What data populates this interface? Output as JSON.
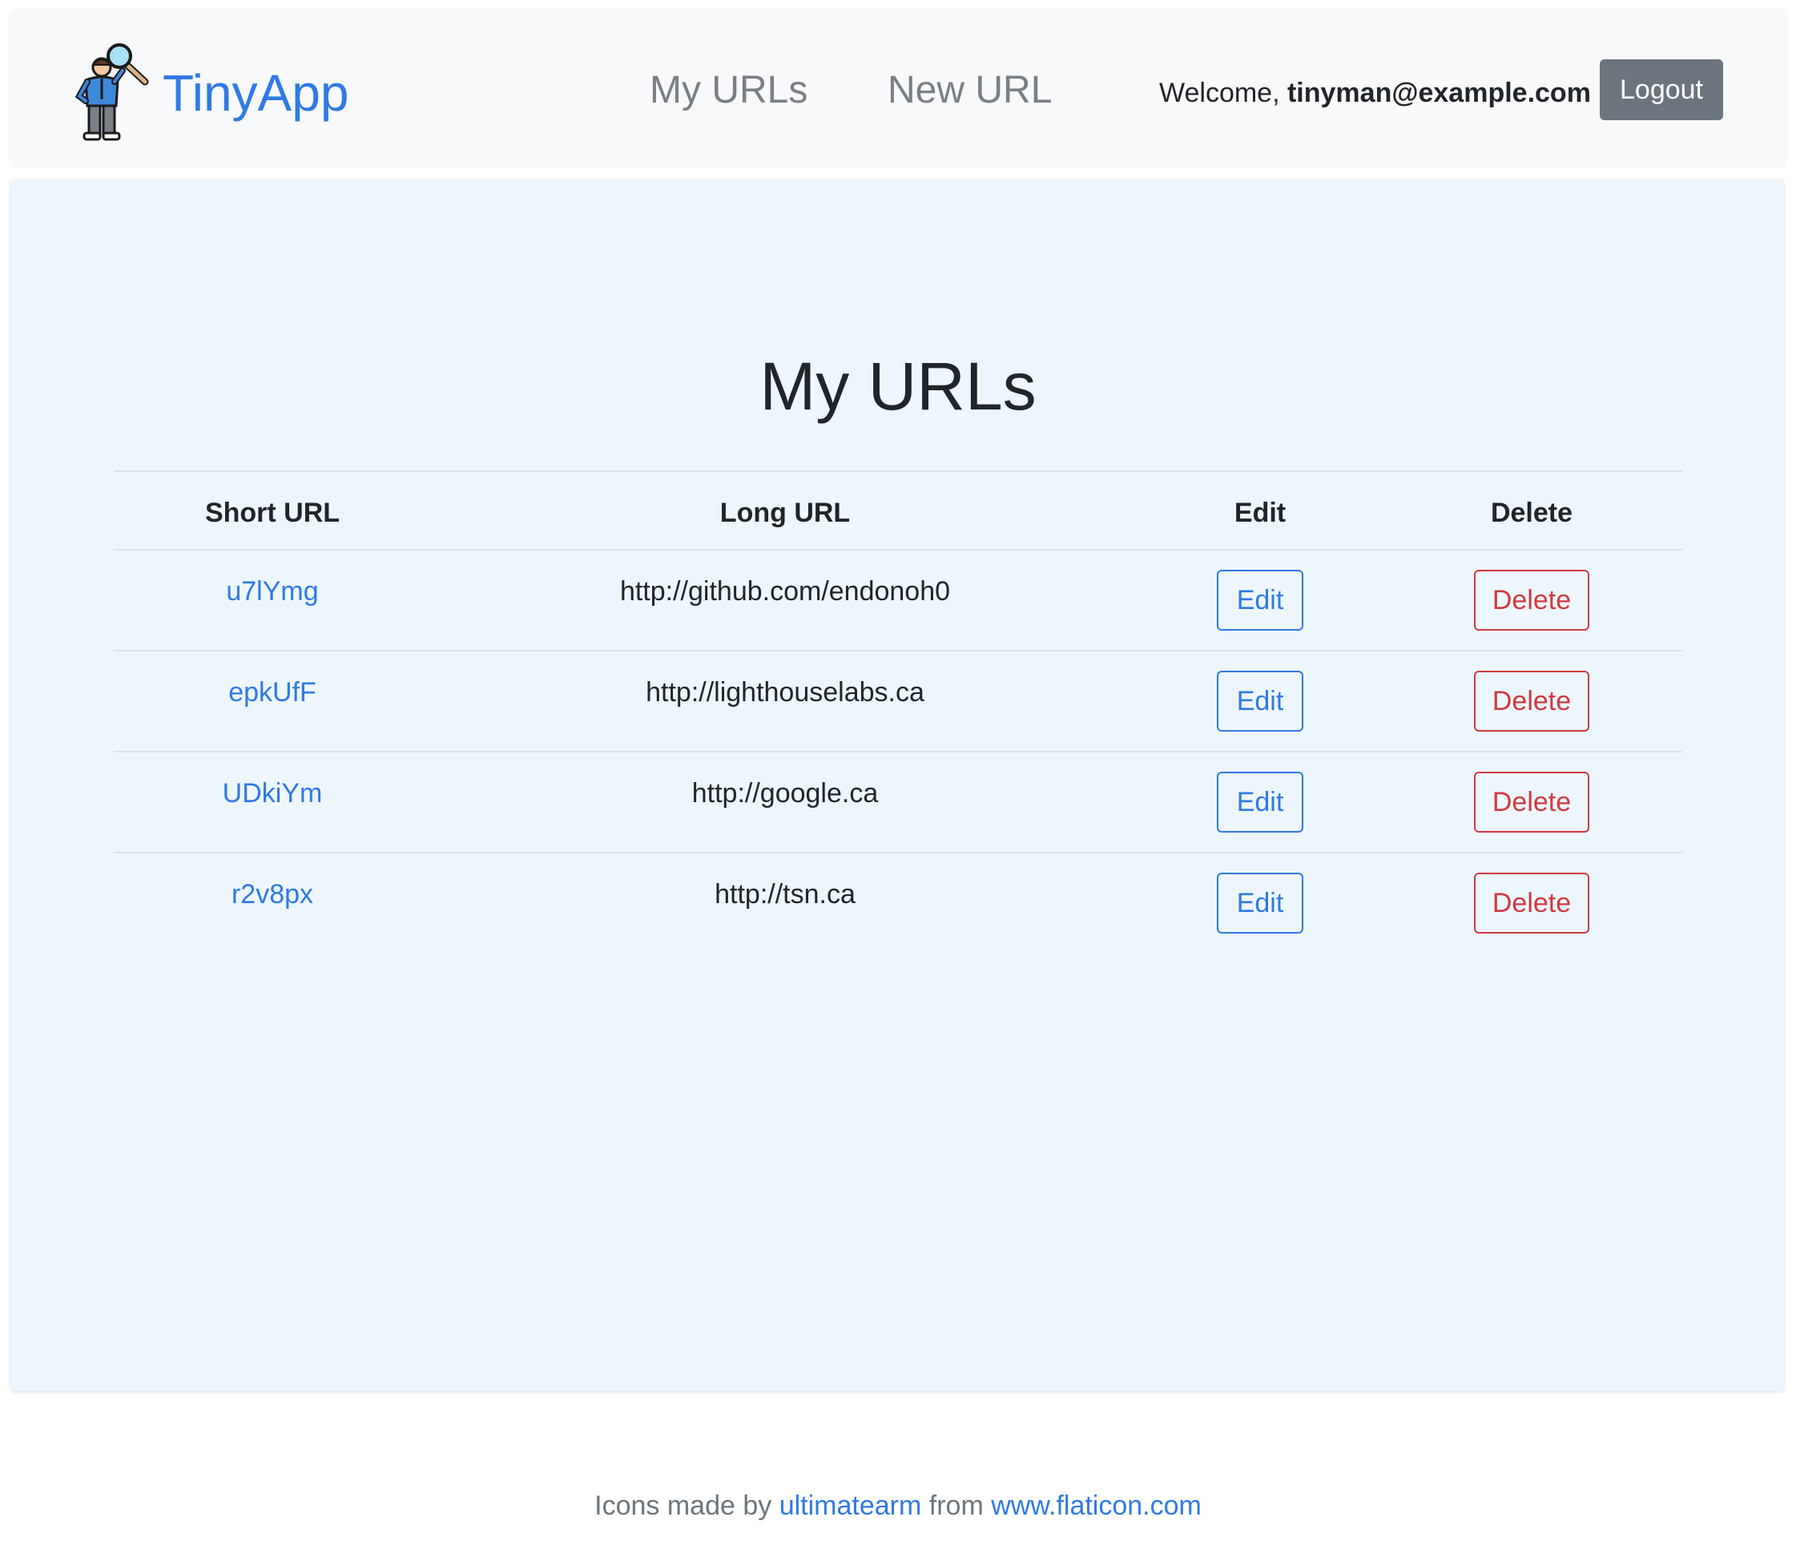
{
  "navbar": {
    "brand_name": "TinyApp",
    "logo_icon": "detective-with-magnifier-icon",
    "links": {
      "my_urls": "My URLs",
      "new_url": "New URL"
    },
    "welcome_prefix": "Welcome,",
    "user_email": "tinyman@example.com",
    "logout_label": "Logout"
  },
  "main": {
    "title": "My URLs",
    "table": {
      "headers": {
        "short_url": "Short URL",
        "long_url": "Long URL",
        "edit": "Edit",
        "delete": "Delete"
      },
      "rows": [
        {
          "short_url": "u7lYmg",
          "long_url": "http://github.com/endonoh0",
          "edit_label": "Edit",
          "delete_label": "Delete"
        },
        {
          "short_url": "epkUfF",
          "long_url": "http://lighthouselabs.ca",
          "edit_label": "Edit",
          "delete_label": "Delete"
        },
        {
          "short_url": "UDkiYm",
          "long_url": "http://google.ca",
          "edit_label": "Edit",
          "delete_label": "Delete"
        },
        {
          "short_url": "r2v8px",
          "long_url": "http://tsn.ca",
          "edit_label": "Edit",
          "delete_label": "Delete"
        }
      ]
    }
  },
  "footer": {
    "prefix": "Icons made by",
    "author": "ultimatearm",
    "middle": "from",
    "site": "www.flaticon.com"
  },
  "colors": {
    "brand": "#2f7ae5",
    "navbar_bg": "#f8f9fa",
    "card_bg": "#eef6fd",
    "logout_bg": "#6c757d",
    "danger": "#d0393f"
  }
}
